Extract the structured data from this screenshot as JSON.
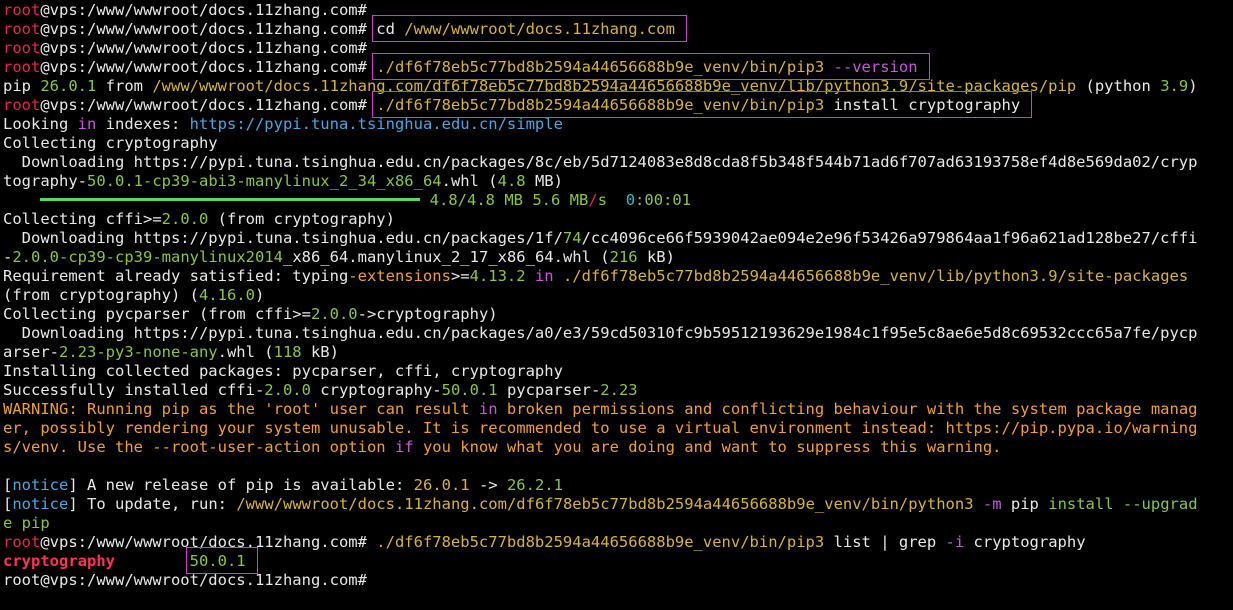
{
  "terminal": {
    "colors": {
      "default": "#e8e8e8",
      "red": "#e8274b",
      "magenta": "#c25ad8",
      "yellow": "#d7b33c",
      "green": "#8cc63f",
      "bright_green": "#5fd35f",
      "blue": "#4da6e0",
      "orange": "#f0a030",
      "cyan": "#3db8c8",
      "bold_red": "#ff3355",
      "highlight_border": "#d23ad2"
    },
    "highlighted_lines": [
      1,
      3,
      5,
      29
    ],
    "lines": [
      [
        {
          "t": "root",
          "c": "red"
        },
        {
          "t": "@vps:/www/wwwroot/docs.11zhang.com#"
        }
      ],
      [
        {
          "t": "root",
          "c": "red"
        },
        {
          "t": "@vps:/www/wwwroot/docs.11zhang.com# "
        },
        {
          "t": "cd "
        },
        {
          "t": "/www/wwwroot/docs.11zhang.com",
          "c": "yellow"
        }
      ],
      [
        {
          "t": "root",
          "c": "red"
        },
        {
          "t": "@vps:/www/wwwroot/docs.11zhang.com#"
        }
      ],
      [
        {
          "t": "root",
          "c": "red"
        },
        {
          "t": "@vps:/www/wwwroot/docs.11zhang.com# "
        },
        {
          "t": "./df6f78eb5c77bd8b2594a44656688b9e_venv/bin/pip3",
          "c": "yellow"
        },
        {
          "t": " "
        },
        {
          "t": "--version",
          "c": "magenta"
        }
      ],
      [
        {
          "t": "pip "
        },
        {
          "t": "26.0.1",
          "c": "green"
        },
        {
          "t": " from "
        },
        {
          "t": "/www/wwwroot/docs.11zhang.com/df6f78eb5c77bd8b2594a44656688b9e_venv/lib/python3.9/site-packages/pip",
          "c": "yellow"
        },
        {
          "t": " (python "
        },
        {
          "t": "3.9",
          "c": "green"
        },
        {
          "t": ")"
        }
      ],
      [
        {
          "t": "root",
          "c": "red"
        },
        {
          "t": "@vps:/www/wwwroot/docs.11zhang.com# "
        },
        {
          "t": "./df6f78eb5c77bd8b2594a44656688b9e_venv/bin/pip3",
          "c": "yellow"
        },
        {
          "t": " install cryptography"
        }
      ],
      [
        {
          "t": "Looking "
        },
        {
          "t": "in",
          "c": "magenta"
        },
        {
          "t": " indexes: "
        },
        {
          "t": "https://pypi.tuna.tsinghua.edu.cn/simple",
          "c": "blue"
        }
      ],
      [
        {
          "t": "Collecting cryptography"
        }
      ],
      [
        {
          "t": "  Downloading https://pypi.tuna.tsinghua.edu.cn/packages/8c/eb/5d7124083e8d8cda8f5b348f544b71ad6f707ad63193758ef4d8e569da02/cryp"
        }
      ],
      [
        {
          "t": "tography-"
        },
        {
          "t": "50.0.1",
          "c": "green"
        },
        {
          "t": "-cp39-abi3-manylinux_2_34_x86_64",
          "c": "green"
        },
        {
          "t": ".whl ("
        },
        {
          "t": "4.8",
          "c": "green"
        },
        {
          "t": " MB)"
        }
      ],
      [
        {
          "t": "    "
        },
        {
          "bar": true
        },
        {
          "t": " "
        },
        {
          "t": "4.8/4.8 MB",
          "c": "green"
        },
        {
          "t": " "
        },
        {
          "t": "5.6 MB",
          "c": "green"
        },
        {
          "t": "/",
          "c": "red"
        },
        {
          "t": "s",
          "c": "green"
        },
        {
          "t": "  "
        },
        {
          "t": "0",
          "c": "cyan"
        },
        {
          "t": ":00:01",
          "c": "green"
        }
      ],
      [
        {
          "t": "Collecting cffi"
        },
        {
          "t": ">=",
          "c": "default"
        },
        {
          "t": "2.0.0",
          "c": "green"
        },
        {
          "t": " (from cryptography)"
        }
      ],
      [
        {
          "t": "  Downloading https://pypi.tuna.tsinghua.edu.cn/packages/1f/"
        },
        {
          "t": "74",
          "c": "green"
        },
        {
          "t": "/cc4096ce66f5939042ae094e2e96f53426a979864aa1f96a621ad128be27/cffi"
        }
      ],
      [
        {
          "t": "-"
        },
        {
          "t": "2.0.0",
          "c": "green"
        },
        {
          "t": "-cp39-cp39-manylinux2014",
          "c": "green"
        },
        {
          "t": "_x86_64.manylinux_2_17_x86_64.whl ("
        },
        {
          "t": "216",
          "c": "green"
        },
        {
          "t": " kB)"
        }
      ],
      [
        {
          "t": "Requirement already satisfied: typing"
        },
        {
          "t": "-extensions",
          "c": "orange"
        },
        {
          "t": ">="
        },
        {
          "t": "4.13.2",
          "c": "green"
        },
        {
          "t": " "
        },
        {
          "t": "in",
          "c": "magenta"
        },
        {
          "t": " "
        },
        {
          "t": "./df6f78eb5c77bd8b2594a44656688b9e_venv/lib/python3.9/site-packages",
          "c": "yellow"
        }
      ],
      [
        {
          "t": "(from cryptography) ("
        },
        {
          "t": "4.16.0",
          "c": "green"
        },
        {
          "t": ")"
        }
      ],
      [
        {
          "t": "Collecting pycparser (from cffi"
        },
        {
          "t": ">="
        },
        {
          "t": "2.0.0",
          "c": "green"
        },
        {
          "t": "->cryptography)"
        }
      ],
      [
        {
          "t": "  Downloading https://pypi.tuna.tsinghua.edu.cn/packages/a0/e3/59cd50310fc9b59512193629e1984c1f95e5c8ae6e5d8c69532ccc65a7fe/pycp"
        }
      ],
      [
        {
          "t": "arser-"
        },
        {
          "t": "2.23-py3-none-any",
          "c": "green"
        },
        {
          "t": ".whl ("
        },
        {
          "t": "118",
          "c": "green"
        },
        {
          "t": " kB)"
        }
      ],
      [
        {
          "t": "Installing collected packages: pycparser, cffi, cryptography"
        }
      ],
      [
        {
          "t": "Successfully installed cffi-"
        },
        {
          "t": "2.0.0",
          "c": "green"
        },
        {
          "t": " cryptography-"
        },
        {
          "t": "50.0.1",
          "c": "green"
        },
        {
          "t": " pycparser-"
        },
        {
          "t": "2.23",
          "c": "green"
        }
      ],
      [
        {
          "t": "WARNING: Running pip as the 'root' user can result ",
          "c": "orange"
        },
        {
          "t": "in",
          "c": "magenta"
        },
        {
          "t": " broken permissions and conflicting behaviour with the system package manag",
          "c": "orange"
        }
      ],
      [
        {
          "t": "er, possibly rendering your system unusable. It is recommended to use a virtual environment instead: https://pip.pypa.io/warning",
          "c": "orange"
        }
      ],
      [
        {
          "t": "s/venv. Use the --root-user-action option ",
          "c": "orange"
        },
        {
          "t": "if",
          "c": "magenta"
        },
        {
          "t": " you know what you are doing and want to suppress this warning.",
          "c": "orange"
        }
      ],
      [
        {
          "t": ""
        }
      ],
      [
        {
          "t": "["
        },
        {
          "t": "notice",
          "c": "blue"
        },
        {
          "t": "] A new release of pip is available: "
        },
        {
          "t": "26.0.1",
          "c": "yellow"
        },
        {
          "t": " -> "
        },
        {
          "t": "26.2.1",
          "c": "green"
        }
      ],
      [
        {
          "t": "["
        },
        {
          "t": "notice",
          "c": "blue"
        },
        {
          "t": "] To update, run: "
        },
        {
          "t": "/www/wwwroot/docs.11zhang.com/df6f78eb5c77bd8b2594a44656688b9e_venv/bin/python3",
          "c": "yellow"
        },
        {
          "t": " "
        },
        {
          "t": "-m",
          "c": "magenta"
        },
        {
          "t": " pip "
        },
        {
          "t": "install --upgrad",
          "c": "green"
        }
      ],
      [
        {
          "t": "e pip",
          "c": "green"
        }
      ],
      [
        {
          "t": "root",
          "c": "red"
        },
        {
          "t": "@vps:/www/wwwroot/docs.11zhang.com# "
        },
        {
          "t": "./df6f78eb5c77bd8b2594a44656688b9e_venv/bin/pip3",
          "c": "yellow"
        },
        {
          "t": " list | grep "
        },
        {
          "t": "-i",
          "c": "magenta"
        },
        {
          "t": " cryptography"
        }
      ],
      [
        {
          "t": "cryptography",
          "c": "bold_red",
          "b": true
        },
        {
          "t": "        "
        },
        {
          "t": "50.0.1",
          "c": "green"
        }
      ],
      [
        {
          "t": "root@vps:/www/wwwroot/docs.11zhang.com#"
        }
      ]
    ]
  }
}
